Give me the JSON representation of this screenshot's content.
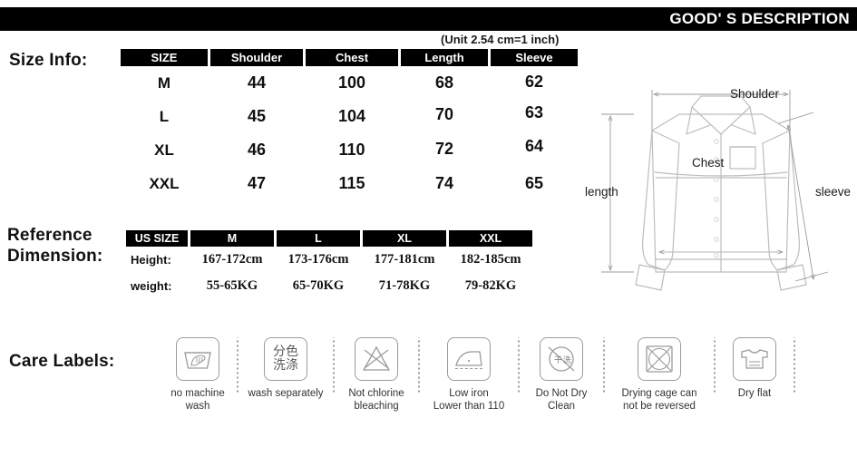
{
  "banner": {
    "title": "GOOD' S DESCRIPTION"
  },
  "unit_note": "(Unit 2.54 cm=1 inch)",
  "labels": {
    "size_info": "Size Info:",
    "reference_dimension": "Reference\nDimension:",
    "care_labels": "Care Labels:"
  },
  "size_table": {
    "headers": [
      "SIZE",
      "Shoulder",
      "Chest",
      "Length",
      "Sleeve"
    ],
    "rows": [
      [
        "M",
        "44",
        "100",
        "68",
        "62"
      ],
      [
        "L",
        "45",
        "104",
        "70",
        "63"
      ],
      [
        "XL",
        "46",
        "110",
        "72",
        "64"
      ],
      [
        "XXL",
        "47",
        "115",
        "74",
        "65"
      ]
    ]
  },
  "reference_table": {
    "headers": [
      "US SIZE",
      "M",
      "L",
      "XL",
      "XXL"
    ],
    "rows": [
      {
        "label": "Height:",
        "values": [
          "167-172cm",
          "173-176cm",
          "177-181cm",
          "182-185cm"
        ]
      },
      {
        "label": "weight:",
        "values": [
          "55-65KG",
          "65-70KG",
          "71-78KG",
          "79-82KG"
        ]
      }
    ]
  },
  "diagram": {
    "shoulder_label": "Shoulder",
    "chest_label": "Chest",
    "length_label": "length",
    "sleeve_label": "sleeve",
    "line_color": "#b9b9b9",
    "arrow_color": "#9a9a9a"
  },
  "care_labels": [
    {
      "icon": "hand-wash-basin-icon",
      "caption": "no machine\nwash"
    },
    {
      "icon": "wash-separately-icon",
      "caption": "wash separately",
      "cn_top": "分色",
      "cn_bottom": "洗涤"
    },
    {
      "icon": "no-chlorine-bleach-icon",
      "caption": "Not chlorine\nbleaching"
    },
    {
      "icon": "low-iron-icon",
      "caption": "Low iron\nLower than 110"
    },
    {
      "icon": "do-not-dry-clean-icon",
      "caption": "Do Not Dry\nClean",
      "cn_left": "干",
      "cn_right": "洗"
    },
    {
      "icon": "no-tumble-dry-icon",
      "caption": "Drying cage can\nnot be reversed"
    },
    {
      "icon": "dry-flat-icon",
      "caption": "Dry flat"
    }
  ],
  "colors": {
    "banner_bg": "#000000",
    "banner_text": "#ffffff",
    "table_header_bg": "#000000",
    "table_header_text": "#ffffff",
    "body_text": "#111111",
    "icon_stroke": "#9b9b9b"
  }
}
